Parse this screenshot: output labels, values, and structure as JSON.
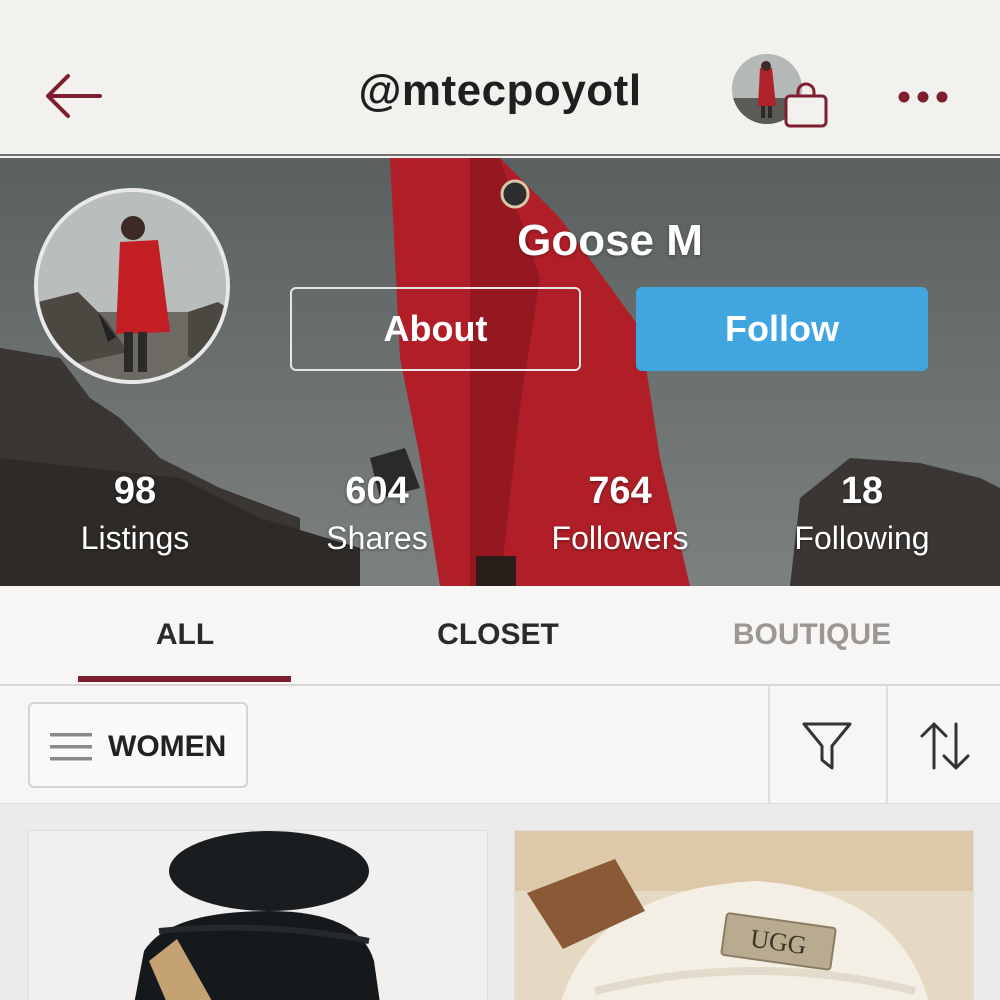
{
  "header": {
    "handle": "@mtecpoyotl",
    "icons": {
      "back": "arrow-left-icon",
      "bag": "shopping-bag-icon",
      "more": "more-dots-icon"
    }
  },
  "profile": {
    "name": "Goose M",
    "about_label": "About",
    "follow_label": "Follow",
    "stats": [
      {
        "value": "98",
        "label": "Listings"
      },
      {
        "value": "604",
        "label": "Shares"
      },
      {
        "value": "764",
        "label": "Followers"
      },
      {
        "value": "18",
        "label": "Following"
      }
    ]
  },
  "tabs": [
    {
      "label": "ALL",
      "active": true
    },
    {
      "label": "CLOSET",
      "active": false
    },
    {
      "label": "BOUTIQUE",
      "active": false
    }
  ],
  "filter": {
    "department_label": "WOMEN",
    "icons": {
      "menu": "menu-lines-icon",
      "filter": "funnel-icon",
      "sort": "sort-arrows-icon"
    }
  },
  "listing_logo_text": "UGG",
  "colors": {
    "accent": "#7d1f2e",
    "follow": "#41a5e0",
    "tab_active": "#2a2a2a",
    "tab_inactive": "#9a9794"
  }
}
